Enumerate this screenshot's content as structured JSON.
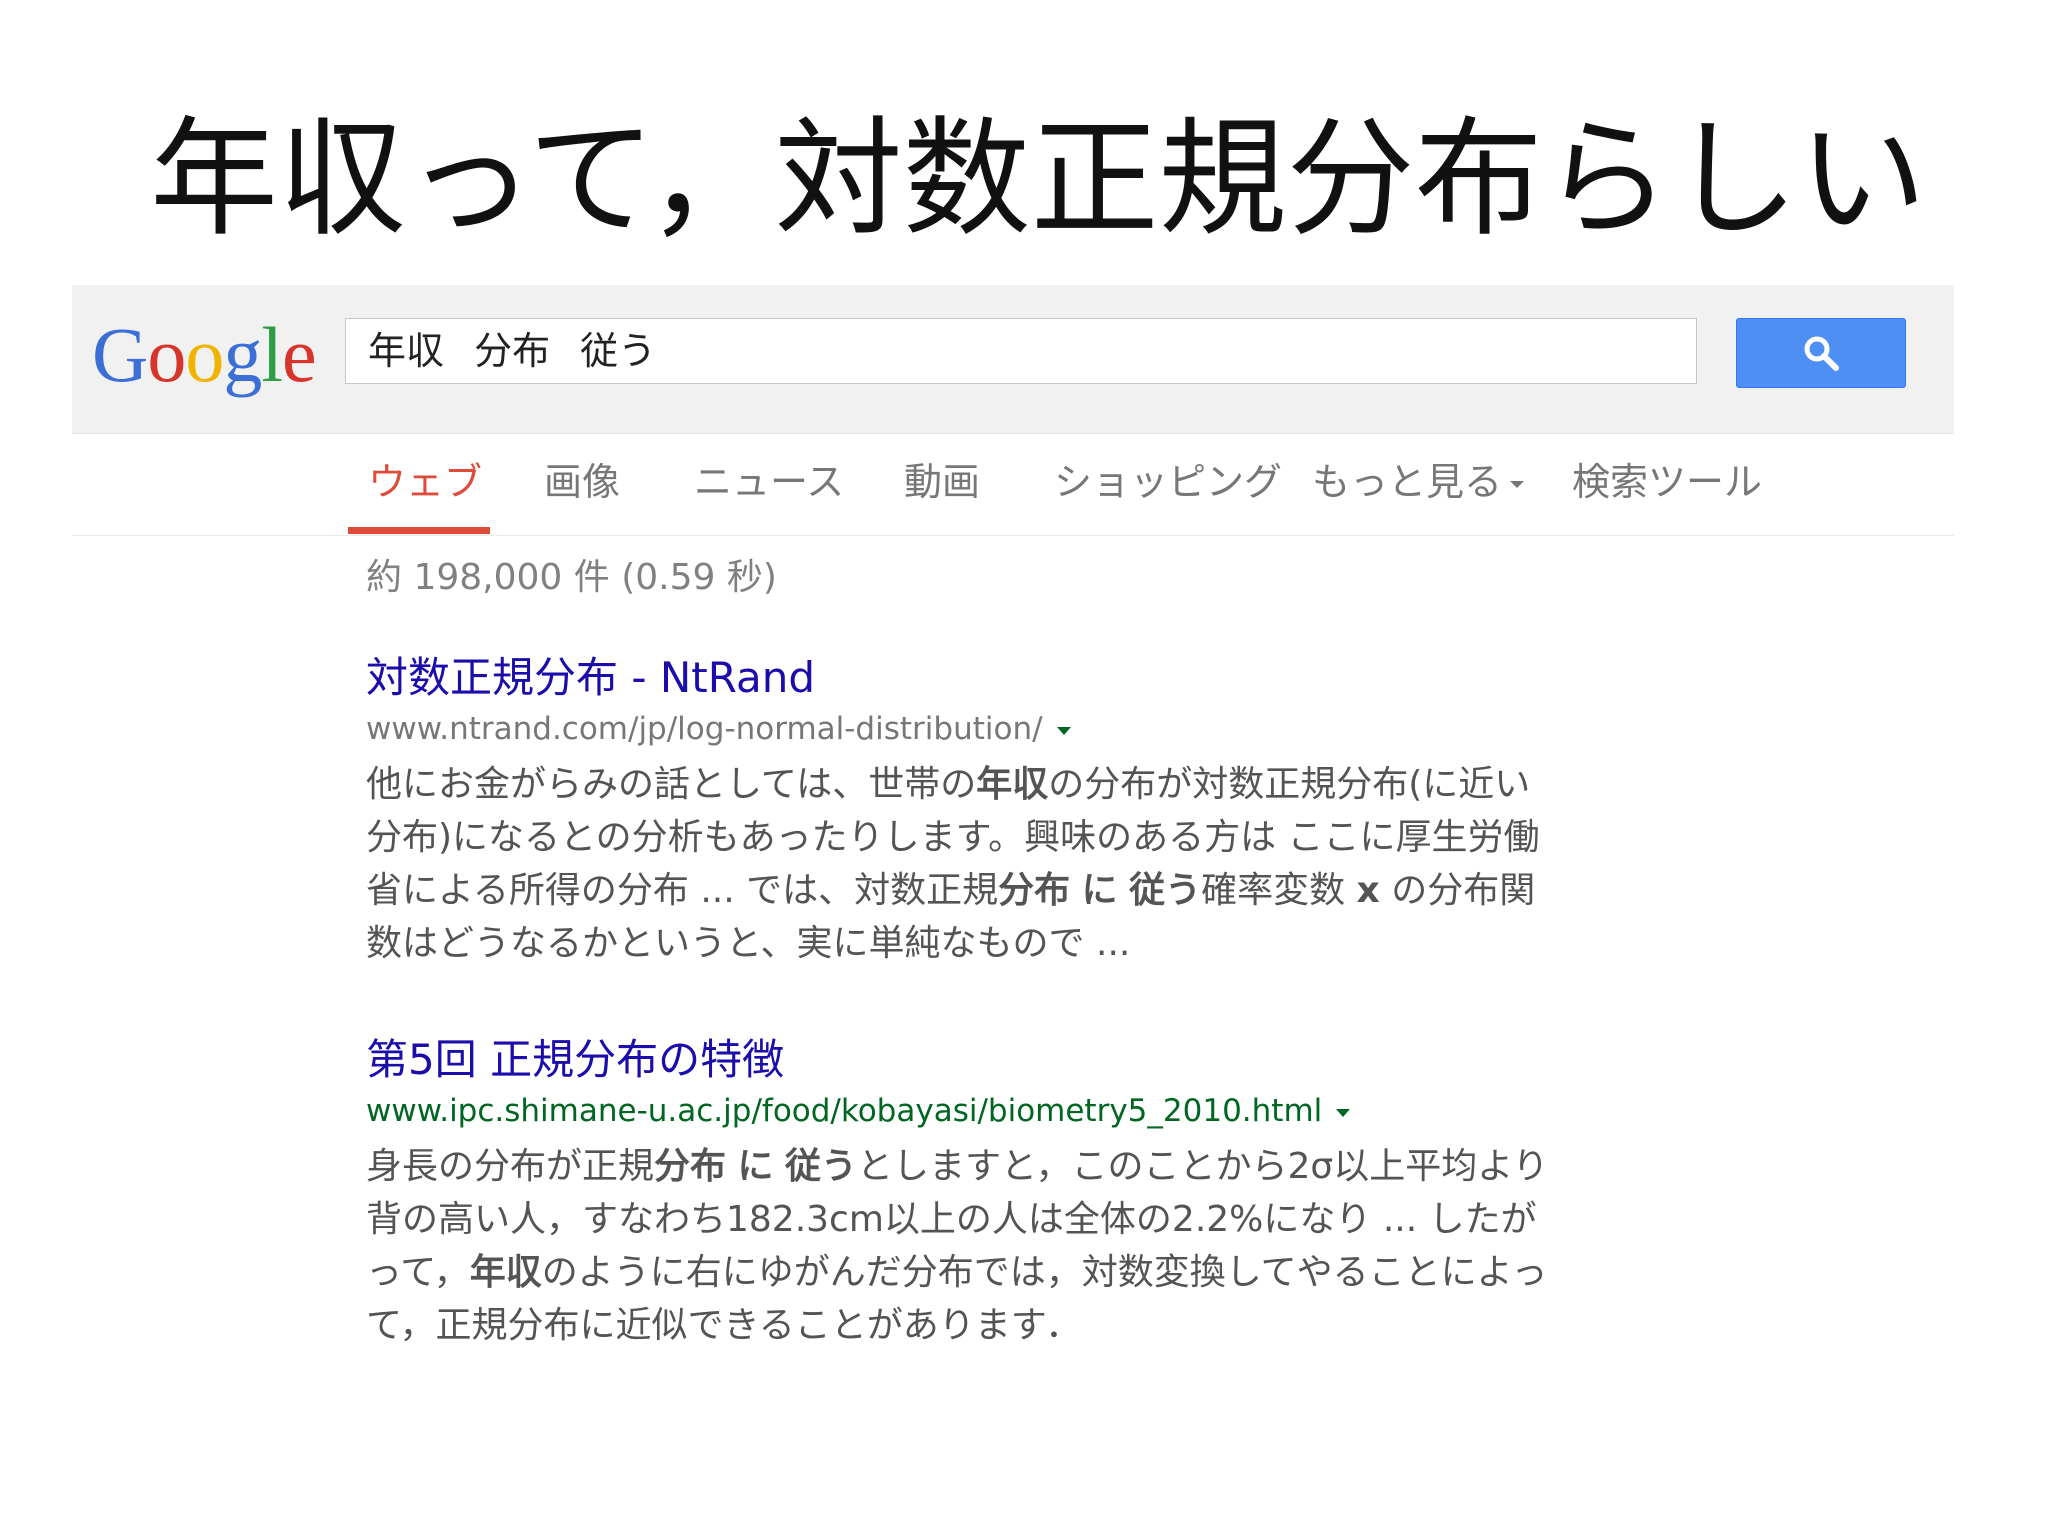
{
  "slide": {
    "title": "年収って，対数正規分布らしい"
  },
  "google": {
    "logo_letters": [
      {
        "ch": "G",
        "color": "#3b6fd6"
      },
      {
        "ch": "o",
        "color": "#d7352b"
      },
      {
        "ch": "o",
        "color": "#f0b400"
      },
      {
        "ch": "g",
        "color": "#3b6fd6"
      },
      {
        "ch": "l",
        "color": "#2f9e47"
      },
      {
        "ch": "e",
        "color": "#d7352b"
      }
    ],
    "query": "年収 分布 従う",
    "search_button_icon": "magnifier-icon"
  },
  "tabs": [
    {
      "label": "ウェブ",
      "active": true
    },
    {
      "label": "画像"
    },
    {
      "label": "ニュース"
    },
    {
      "label": "動画"
    },
    {
      "label": "ショッピング"
    },
    {
      "label": "もっと見る"
    },
    {
      "label": "検索ツール"
    }
  ],
  "result_stats": "約 198,000 件 (0.59 秒)",
  "results": [
    {
      "title": "対数正規分布 - NtRand",
      "url": "www.ntrand.com/jp/log-normal-distribution/",
      "snippet_parts": [
        {
          "t": "他にお金がらみの話としては、世帯の"
        },
        {
          "t": "年収",
          "b": true
        },
        {
          "t": "の分布が対数正規分布(に近い分布)になるとの分析もあったりします。興味のある方は ここに厚生労働省による所得の分布 ... では、対数正規"
        },
        {
          "t": "分布",
          "b": true
        },
        {
          "t": " "
        },
        {
          "t": "に",
          "b": true
        },
        {
          "t": " "
        },
        {
          "t": "従う",
          "b": true
        },
        {
          "t": "確率変数 "
        },
        {
          "t": "x",
          "b": true
        },
        {
          "t": " の分布関数はどうなるかというと、実に単純なもので ..."
        }
      ]
    },
    {
      "title": "第5回 正規分布の特徴",
      "url": "www.ipc.shimane-u.ac.jp/food/kobayasi/biometry5_2010.html",
      "snippet_parts": [
        {
          "t": "身長の分布が正規"
        },
        {
          "t": "分布",
          "b": true
        },
        {
          "t": " "
        },
        {
          "t": "に",
          "b": true
        },
        {
          "t": " "
        },
        {
          "t": "従う",
          "b": true
        },
        {
          "t": "としますと，このことから2σ以上平均より背の高い人，すなわち182.3cm以上の人は全体の2.2%になり ... したがって，"
        },
        {
          "t": "年収",
          "b": true
        },
        {
          "t": "のように右にゆがんだ分布では，対数変換してやることによって，正規分布に近似できることがあります．"
        }
      ]
    }
  ]
}
